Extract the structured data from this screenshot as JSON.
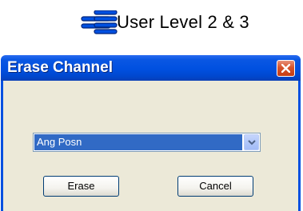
{
  "header": {
    "level_text": "User Level 2 & 3",
    "icon_color": "#0050e0"
  },
  "dialog": {
    "title": "Erase Channel",
    "close_icon": "close-icon",
    "channel_select": {
      "selected": "Ang Posn"
    },
    "buttons": {
      "erase": "Erase",
      "cancel": "Cancel"
    },
    "colors": {
      "titlebar": "#0050e0",
      "body": "#ece9d8",
      "selection": "#316ac5",
      "close": "#d6532b"
    }
  }
}
